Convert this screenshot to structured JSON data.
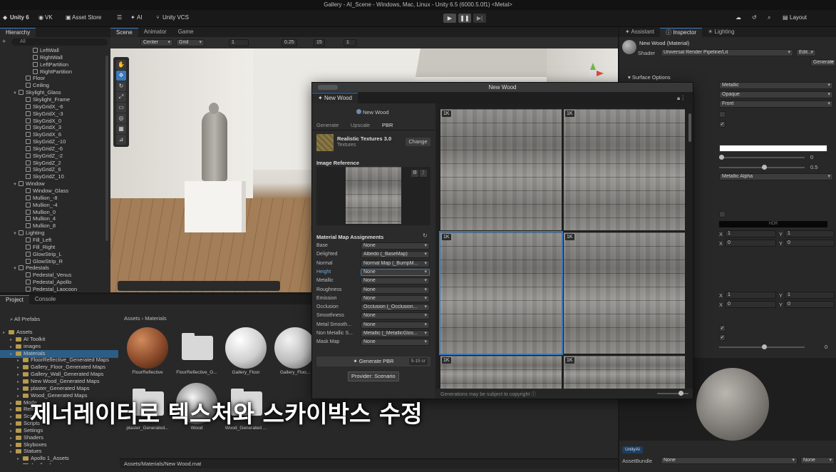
{
  "window_title": "Gallery - AI_Scene - Windows, Mac, Linux - Unity 6.5 (6000.5.0f1) <Metal>",
  "toolbar": {
    "unity_label": "Unity 6",
    "account": "VK",
    "asset_store": "Asset Store",
    "ai": "AI",
    "vcs": "Unity VCS",
    "layout": "Layout"
  },
  "hierarchy": {
    "tab": "Hierarchy",
    "search_placeholder": "All",
    "items": [
      {
        "label": "LeftWall",
        "depth": 3,
        "kind": "obj"
      },
      {
        "label": "RightWall",
        "depth": 3,
        "kind": "obj"
      },
      {
        "label": "LeftPartition",
        "depth": 3,
        "kind": "obj"
      },
      {
        "label": "RightPartition",
        "depth": 3,
        "kind": "obj"
      },
      {
        "label": "Floor",
        "depth": 2,
        "kind": "obj"
      },
      {
        "label": "Ceiling",
        "depth": 2,
        "kind": "obj"
      },
      {
        "label": "Skylight_Glass",
        "depth": 1,
        "kind": "group"
      },
      {
        "label": "Skylight_Frame",
        "depth": 2,
        "kind": "obj"
      },
      {
        "label": "SkyGridX_-6",
        "depth": 2,
        "kind": "obj"
      },
      {
        "label": "SkyGridX_-3",
        "depth": 2,
        "kind": "obj"
      },
      {
        "label": "SkyGridX_0",
        "depth": 2,
        "kind": "obj"
      },
      {
        "label": "SkyGridX_3",
        "depth": 2,
        "kind": "obj"
      },
      {
        "label": "SkyGridX_6",
        "depth": 2,
        "kind": "obj"
      },
      {
        "label": "SkyGridZ_-10",
        "depth": 2,
        "kind": "obj"
      },
      {
        "label": "SkyGridZ_-6",
        "depth": 2,
        "kind": "obj"
      },
      {
        "label": "SkyGridZ_-2",
        "depth": 2,
        "kind": "obj"
      },
      {
        "label": "SkyGridZ_2",
        "depth": 2,
        "kind": "obj"
      },
      {
        "label": "SkyGridZ_6",
        "depth": 2,
        "kind": "obj"
      },
      {
        "label": "SkyGridZ_10",
        "depth": 2,
        "kind": "obj"
      },
      {
        "label": "Window",
        "depth": 1,
        "kind": "group"
      },
      {
        "label": "Window_Glass",
        "depth": 2,
        "kind": "obj"
      },
      {
        "label": "Mullion_-8",
        "depth": 2,
        "kind": "obj"
      },
      {
        "label": "Mullion_-4",
        "depth": 2,
        "kind": "obj"
      },
      {
        "label": "Mullion_0",
        "depth": 2,
        "kind": "obj"
      },
      {
        "label": "Mullion_4",
        "depth": 2,
        "kind": "obj"
      },
      {
        "label": "Mullion_8",
        "depth": 2,
        "kind": "obj"
      },
      {
        "label": "Lighting",
        "depth": 1,
        "kind": "group"
      },
      {
        "label": "Fill_Left",
        "depth": 2,
        "kind": "obj"
      },
      {
        "label": "Fill_Right",
        "depth": 2,
        "kind": "obj"
      },
      {
        "label": "GlowStrip_L",
        "depth": 2,
        "kind": "obj"
      },
      {
        "label": "GlowStrip_R",
        "depth": 2,
        "kind": "obj"
      },
      {
        "label": "Pedestals",
        "depth": 1,
        "kind": "group"
      },
      {
        "label": "Pedestal_Venus",
        "depth": 2,
        "kind": "obj"
      },
      {
        "label": "Pedestal_Apollo",
        "depth": 2,
        "kind": "obj"
      },
      {
        "label": "Pedestal_Laocoon",
        "depth": 2,
        "kind": "obj"
      }
    ]
  },
  "scene": {
    "tabs": [
      "Scene",
      "Animator",
      "Game"
    ],
    "pivot": "Center",
    "grid": "Grid",
    "snap_value": "1",
    "snap_increment": "0.25",
    "rotation_snap": "15",
    "scale_snap": "1"
  },
  "project": {
    "tabs": [
      "Project",
      "Console"
    ],
    "favorites": "All Prefabs",
    "breadcrumb": [
      "Assets",
      "Materials"
    ],
    "tree": [
      {
        "label": "Assets",
        "depth": 0
      },
      {
        "label": "AI Toolkit",
        "depth": 1
      },
      {
        "label": "images",
        "depth": 1
      },
      {
        "label": "Materials",
        "depth": 1
      },
      {
        "label": "FloorReflective_Generated Maps",
        "depth": 2
      },
      {
        "label": "Gallery_Floor_Generated Maps",
        "depth": 2
      },
      {
        "label": "Gallery_Wall_Generated Maps",
        "depth": 2
      },
      {
        "label": "New Wood_Generated Maps",
        "depth": 2
      },
      {
        "label": "plaster_Generated Maps",
        "depth": 2
      },
      {
        "label": "Wood_Generated Maps",
        "depth": 2
      },
      {
        "label": "Mode",
        "depth": 1
      },
      {
        "label": "Refle",
        "depth": 1
      },
      {
        "label": "Scen",
        "depth": 1
      },
      {
        "label": "Scripts",
        "depth": 1
      },
      {
        "label": "Settings",
        "depth": 1
      },
      {
        "label": "Shaders",
        "depth": 1
      },
      {
        "label": "Skyboxes",
        "depth": 1
      },
      {
        "label": "Statues",
        "depth": 1
      },
      {
        "label": "Apollo 1_Assets",
        "depth": 2
      },
      {
        "label": "Apollo_Assets",
        "depth": 2
      }
    ],
    "assets": [
      {
        "label": "FloorReflective",
        "kind": "sphere-brown"
      },
      {
        "label": "FloorReflective_G...",
        "kind": "folder"
      },
      {
        "label": "Gallery_Floor",
        "kind": "sphere-white"
      },
      {
        "label": "Gallery_Floo...",
        "kind": "sphere-marble"
      },
      {
        "label": "plaster_Generated...",
        "kind": "folder"
      },
      {
        "label": "Wood",
        "kind": "sphere-chrome"
      },
      {
        "label": "Wood_Generated ...",
        "kind": "folder"
      }
    ],
    "footer_path": "Assets/Materials/New Wood.mat"
  },
  "generator": {
    "window_title": "New Wood",
    "tab": "New Wood",
    "asset_name": "New Wood",
    "modes": [
      "Generate",
      "Upscale",
      "PBR"
    ],
    "active_mode": "PBR",
    "model_name": "Realistic Textures 3.0",
    "model_type": "Textures",
    "change_label": "Change",
    "image_reference_label": "Image Reference",
    "map_assignments_label": "Material Map Assignments",
    "maps": [
      {
        "label": "Base",
        "value": "None"
      },
      {
        "label": "Delighted",
        "value": "Albedo (_BaseMap)"
      },
      {
        "label": "Normal",
        "value": "Normal Map (_BumpM..."
      },
      {
        "label": "Height",
        "value": "None"
      },
      {
        "label": "Metallic",
        "value": "None"
      },
      {
        "label": "Roughness",
        "value": "None"
      },
      {
        "label": "Emission",
        "value": "None"
      },
      {
        "label": "Occlusion",
        "value": "Occlusion (_Occlusion..."
      },
      {
        "label": "Smoothness",
        "value": "None"
      },
      {
        "label": "Metal Smooth...",
        "value": "None"
      },
      {
        "label": "Non Metallic S...",
        "value": "Metallic (_MetallicGlos..."
      },
      {
        "label": "Mask Map",
        "value": "None"
      }
    ],
    "generate_label": "Generate PBR",
    "cost_label": "5-15 cr",
    "tooltip": "Provider: Scenario",
    "results": [
      "1K",
      "1K",
      "1K",
      "1K",
      "1K",
      "1K"
    ],
    "footer_note": "Generations may be subject to copyright"
  },
  "inspector": {
    "tabs": [
      "Assistant",
      "Inspector",
      "Lighting"
    ],
    "material_name": "New Wood (Material)",
    "shader_label": "Shader",
    "shader_value": "Universal Render Pipeline/Lit",
    "edit_label": "Edit...",
    "generate_label": "Generate",
    "surface_options": "Surface Options",
    "workflow": "Metallic",
    "surface_type": "Opaque",
    "render_face": "Front",
    "metallic_value": "0",
    "smoothness_value": "0.5",
    "source": "Metallic Alpha",
    "tiling_x": "1",
    "tiling_y": "1",
    "offset_x": "0",
    "offset_y": "0",
    "tiling2_x": "1",
    "tiling2_y": "1",
    "offset2_x": "0",
    "offset2_y": "0",
    "sort_priority": "0",
    "hdr_label": "HDR",
    "x_label": "X",
    "y_label": "Y",
    "asset_label": "UnityAI",
    "asset_bundle_label": "AssetBundle",
    "asset_bundle_value": "None",
    "asset_bundle_variant": "None"
  },
  "subtitle": "제너레이터로 텍스처와 스카이박스 수정",
  "colors": {
    "accent": "#3a79bb",
    "selection": "#2c5d87",
    "panel": "#282828",
    "toolbar": "#191919"
  }
}
